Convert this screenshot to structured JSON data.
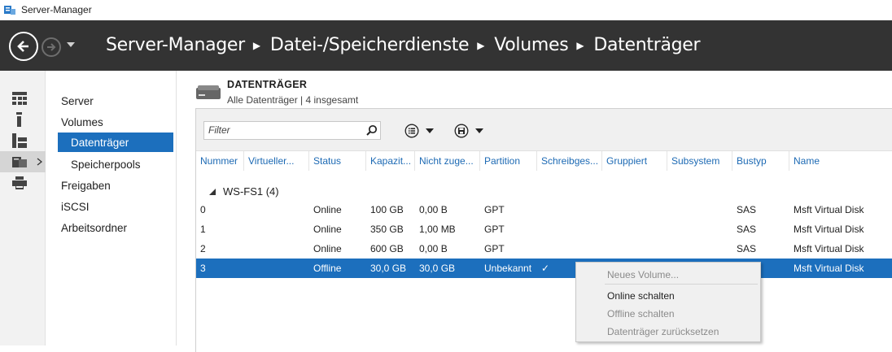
{
  "window": {
    "title": "Server-Manager"
  },
  "header": {
    "breadcrumb": [
      "Server-Manager",
      "Datei-/Speicherdienste",
      "Volumes",
      "Datenträger"
    ]
  },
  "sidebar": {
    "items": [
      {
        "label": "Server"
      },
      {
        "label": "Volumes"
      },
      {
        "label": "Datenträger"
      },
      {
        "label": "Speicherpools"
      },
      {
        "label": "Freigaben"
      },
      {
        "label": "iSCSI"
      },
      {
        "label": "Arbeitsordner"
      }
    ]
  },
  "section": {
    "title": "DATENTRÄGER",
    "subtitle": "Alle Datenträger | 4 insgesamt"
  },
  "filter": {
    "placeholder": "Filter"
  },
  "table": {
    "columns": [
      "Nummer",
      "Virtueller...",
      "Status",
      "Kapazit...",
      "Nicht zuge...",
      "Partition",
      "Schreibges...",
      "Gruppiert",
      "Subsystem",
      "Bustyp",
      "Name"
    ],
    "group": "WS-FS1 (4)",
    "rows": [
      {
        "nummer": "0",
        "status": "Online",
        "kapazitaet": "100 GB",
        "nicht_zugeordnet": "0,00 B",
        "partition": "GPT",
        "schreibgeschuetzt": "",
        "bustyp": "SAS",
        "name": "Msft Virtual Disk"
      },
      {
        "nummer": "1",
        "status": "Online",
        "kapazitaet": "350 GB",
        "nicht_zugeordnet": "1,00 MB",
        "partition": "GPT",
        "schreibgeschuetzt": "",
        "bustyp": "SAS",
        "name": "Msft Virtual Disk"
      },
      {
        "nummer": "2",
        "status": "Online",
        "kapazitaet": "600 GB",
        "nicht_zugeordnet": "0,00 B",
        "partition": "GPT",
        "schreibgeschuetzt": "",
        "bustyp": "SAS",
        "name": "Msft Virtual Disk"
      },
      {
        "nummer": "3",
        "status": "Offline",
        "kapazitaet": "30,0 GB",
        "nicht_zugeordnet": "30,0 GB",
        "partition": "Unbekannt",
        "schreibgeschuetzt": "✓",
        "bustyp": "",
        "name": "Msft Virtual Disk"
      }
    ]
  },
  "context_menu": {
    "items": [
      {
        "label": "Neues Volume...",
        "enabled": false
      },
      {
        "label": "Online schalten",
        "enabled": true
      },
      {
        "label": "Offline schalten",
        "enabled": false
      },
      {
        "label": "Datenträger zurücksetzen",
        "enabled": false
      }
    ]
  },
  "colors": {
    "header_bg": "#333333",
    "accent": "#1c6fbd",
    "column_header": "#1d6ab4"
  }
}
